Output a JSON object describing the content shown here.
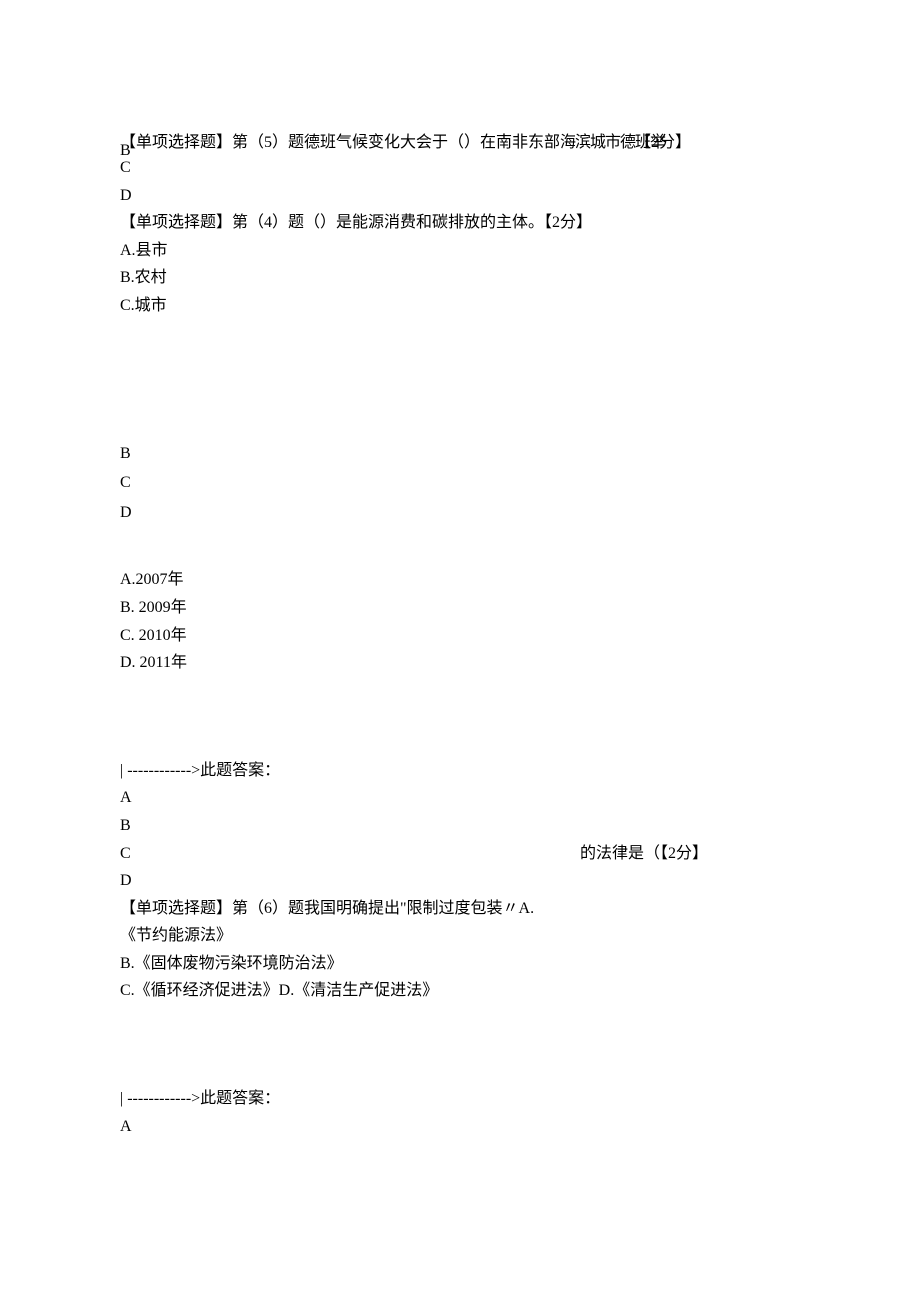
{
  "line1_part1": "【单项选择题】第（5）题德班气候变化大会于（）在南非东部",
  "line1_part2": "海滨城市德班举",
  "line1_part3": "【2分】",
  "line1_b": "B",
  "line2": "C",
  "line3": "D",
  "q4_text": "【单项选择题】第（4）题（）是能源消费和碳排放的主体。【2分】",
  "q4_optA": "A.县市",
  "q4_optB": "B.农村",
  "q4_optC": "C.城市",
  "block2_b": "B",
  "block2_c": "C",
  "block2_d": "D",
  "q5_optA": "A.2007年",
  "q5_optB": "B. 2009年",
  "q5_optC": "C. 2010年",
  "q5_optD": "D. 2011年",
  "answer_label": "| ------------>此题答案：",
  "ans_a": "A",
  "ans_b": "B",
  "ans_c": "C",
  "ans_d": "D",
  "float_law": "的法律是（【2分】",
  "q6_text": "【单项选择题】第（6）题我国明确提出\"限制过度包装〃A.",
  "q6_optA": "《节约能源法》",
  "q6_optB": "B.《固体废物污染环境防治法》",
  "q6_optCD": "C.《循环经济促进法》D.《清洁生产促进法》",
  "answer_label2": "| ------------>此题答案：",
  "ans2_a": "A"
}
